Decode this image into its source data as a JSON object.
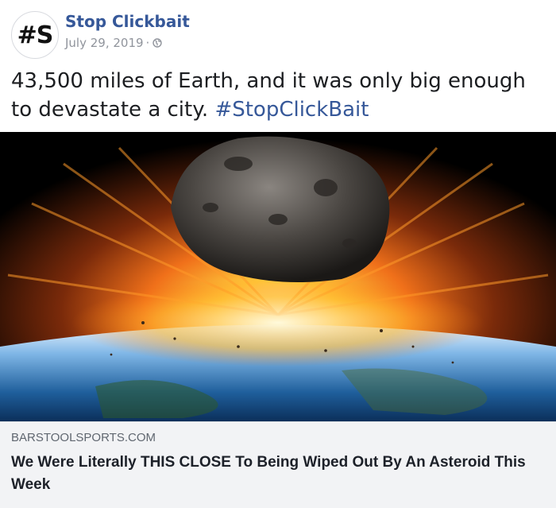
{
  "post": {
    "avatar_text": "#S",
    "page_name": "Stop Clickbait",
    "date": "July 29, 2019",
    "separator": "·",
    "privacy_icon": "globe-icon",
    "text": "43,500 miles of Earth, and it was only big enough to devastate a city.",
    "hashtag": "#StopClickBait"
  },
  "link_preview": {
    "domain": "BARSTOOLSPORTS.COM",
    "title": "We Were Literally THIS CLOSE To Being Wiped Out By An Asteroid This Week"
  },
  "colors": {
    "link_blue": "#365899",
    "meta_gray": "#90949c",
    "preview_bg": "#f2f3f5"
  }
}
